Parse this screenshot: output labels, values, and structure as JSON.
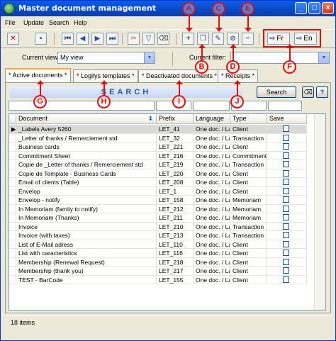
{
  "window": {
    "title": "Master document management",
    "minimize": "_",
    "maximize": "□",
    "close": "×"
  },
  "menu": [
    "File",
    "Update",
    "Search",
    "Help"
  ],
  "toolbar": {
    "lang_fr": "Fr",
    "lang_en": "En"
  },
  "callouts": {
    "A": "A",
    "B": "B",
    "C": "C",
    "D": "D",
    "E": "E",
    "F": "F",
    "G": "G",
    "H": "H",
    "I": "I",
    "J": "J"
  },
  "filters": {
    "current_view_label": "Current view:",
    "current_view_value": "My view",
    "current_filter_label": "Current filter:",
    "current_filter_value": ""
  },
  "tabs": [
    {
      "label": "* Active documents *"
    },
    {
      "label": "* Logilys templates *"
    },
    {
      "label": "* Deactivated documents *"
    },
    {
      "label": "* Receipts *"
    }
  ],
  "search": {
    "header": "SEARCH",
    "button": "Search",
    "help": "?"
  },
  "table": {
    "columns": [
      "Document",
      "Prefix",
      "Language",
      "Type",
      "Save"
    ],
    "rows": [
      {
        "document": "_Labels Avery 5260",
        "prefix": "LET_41",
        "language": "One doc. / La",
        "type": "Client"
      },
      {
        "document": "_Letter of thanks / Remerciement std",
        "prefix": "LET_32",
        "language": "One doc. / La",
        "type": "Transaction"
      },
      {
        "document": "Business cards",
        "prefix": "LET_221",
        "language": "One doc. / La",
        "type": "Client"
      },
      {
        "document": "Commitment Sheet",
        "prefix": "LET_216",
        "language": "One doc. / La",
        "type": "Commitment"
      },
      {
        "document": "Copie de _Letter of thanks / Remerciement std",
        "prefix": "LET_219",
        "language": "One doc. / La",
        "type": "Transaction"
      },
      {
        "document": "Copie de Template - Business Cards",
        "prefix": "LET_220",
        "language": "One doc. / La",
        "type": "Client"
      },
      {
        "document": "Email of clients (Table)",
        "prefix": "LET_208",
        "language": "One doc. / La",
        "type": "Client"
      },
      {
        "document": "Envelop",
        "prefix": "LET_1",
        "language": "One doc. / La",
        "type": "Client"
      },
      {
        "document": "Envelop - notify",
        "prefix": "LET_158",
        "language": "One doc. / La",
        "type": "Memoriam"
      },
      {
        "document": "In Memoriam (family to notify)",
        "prefix": "LET_212",
        "language": "One doc. / La",
        "type": "Memoriam"
      },
      {
        "document": "In Memoriam (Thanks)",
        "prefix": "LET_211",
        "language": "One doc. / La",
        "type": "Memoriam"
      },
      {
        "document": "Invoice",
        "prefix": "LET_210",
        "language": "One doc. / La",
        "type": "Transaction"
      },
      {
        "document": "Invoice (with taxes)",
        "prefix": "LET_213",
        "language": "One doc. / La",
        "type": "Transaction"
      },
      {
        "document": "List of E-Mail adress",
        "prefix": "LET_110",
        "language": "One doc. / La",
        "type": "Client"
      },
      {
        "document": "List with caracteristics",
        "prefix": "LET_116",
        "language": "One doc. / La",
        "type": "Client"
      },
      {
        "document": "Membership (Renewal Request)",
        "prefix": "LET_218",
        "language": "One doc. / La",
        "type": "Client"
      },
      {
        "document": "Membership (thank you)",
        "prefix": "LET_217",
        "language": "One doc. / La",
        "type": "Client"
      },
      {
        "document": "TEST - BarCode",
        "prefix": "LET_155",
        "language": "One doc. / La",
        "type": "Client"
      }
    ]
  },
  "status": {
    "count": "18 items"
  },
  "colors": {
    "callout": "#e01010",
    "title_bar": "#0a5fe8",
    "selected_row": "#d9d9d9"
  }
}
